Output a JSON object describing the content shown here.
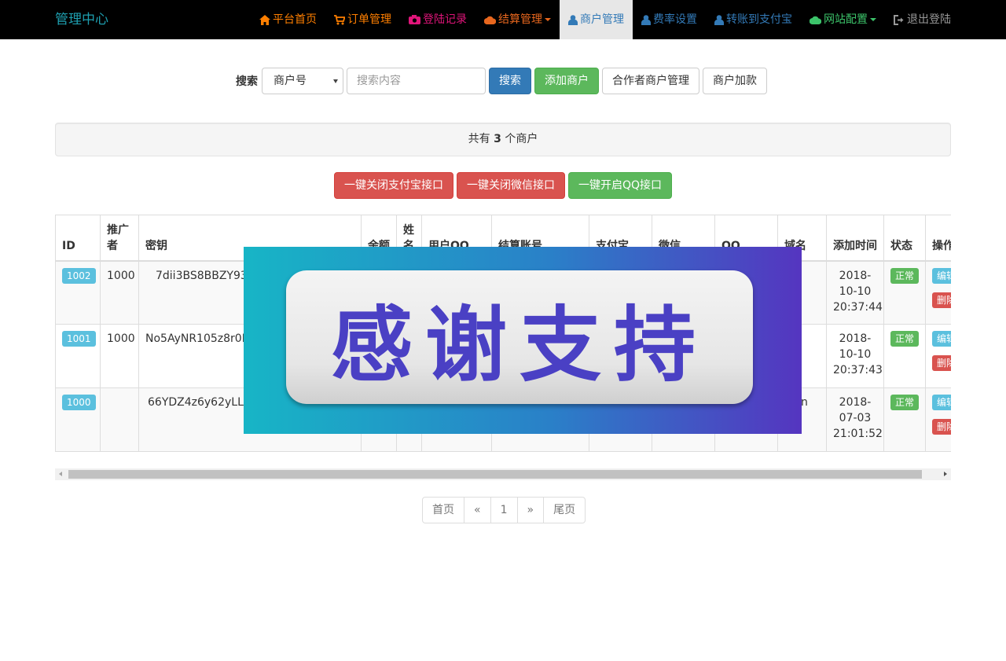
{
  "navbar": {
    "brand": "管理中心",
    "items": [
      {
        "label": "平台首页",
        "icon": "home-icon",
        "color": "#ff7f00"
      },
      {
        "label": "订单管理",
        "icon": "cart-icon",
        "color": "#ff7f00"
      },
      {
        "label": "登陆记录",
        "icon": "camera-icon",
        "color": "#e0157a"
      },
      {
        "label": "结算管理",
        "icon": "cloud-icon",
        "color": "#e8671e",
        "dropdown": true
      },
      {
        "label": "商户管理",
        "icon": "user-icon",
        "color": "#337ab7",
        "active": true
      },
      {
        "label": "费率设置",
        "icon": "user-icon",
        "color": "#337ab7"
      },
      {
        "label": "转账到支付宝",
        "icon": "user-icon",
        "color": "#337ab7"
      },
      {
        "label": "网站配置",
        "icon": "cloud-icon",
        "color": "#3cc36a",
        "dropdown": true
      },
      {
        "label": "退出登陆",
        "icon": "logout-icon",
        "color": "#999999"
      }
    ]
  },
  "search": {
    "label": "搜索",
    "select_value": "商户号",
    "placeholder": "搜索内容",
    "search_button": "搜索",
    "add_button": "添加商户",
    "partner_button": "合作者商户管理",
    "add_funds_button": "商户加款"
  },
  "summary": {
    "prefix": "共有",
    "count": "3",
    "suffix": "个商户"
  },
  "actions": {
    "close_alipay": "一键关闭支付宝接口",
    "close_wechat": "一键关闭微信接口",
    "open_qq": "一键开启QQ接口"
  },
  "table": {
    "headers": [
      "ID",
      "推广者",
      "密钥",
      "余额",
      "姓名",
      "用户QQ",
      "结算账号",
      "支付宝",
      "微信",
      "QQ",
      "域名",
      "添加时间",
      "状态",
      "操作"
    ],
    "rows": [
      {
        "id": "1002",
        "promoter": "1000",
        "key": "7dii3BS8BBZY93r",
        "domain": "",
        "date": "2018-",
        "date2": "10-10",
        "time": "20:37:44",
        "status": "正常",
        "edit": "编辑",
        "delete": "删除"
      },
      {
        "id": "1001",
        "promoter": "1000",
        "key": "No5AyNR105z8r0RN",
        "domain": "",
        "date": "2018-",
        "date2": "10-10",
        "time": "20:37:43",
        "status": "正常",
        "edit": "编辑",
        "delete": "删除"
      },
      {
        "id": "1000",
        "promoter": "",
        "key": "66YDZ4z6y62yLLh",
        "domain": "7.cn",
        "date": "2018-",
        "date2": "07-03",
        "time": "21:01:52",
        "status": "正常",
        "edit": "编辑",
        "delete": "删除"
      }
    ]
  },
  "pagination": {
    "first": "首页",
    "prev": "«",
    "current": "1",
    "next": "»",
    "last": "尾页"
  },
  "banner": {
    "text": "感谢支持"
  }
}
